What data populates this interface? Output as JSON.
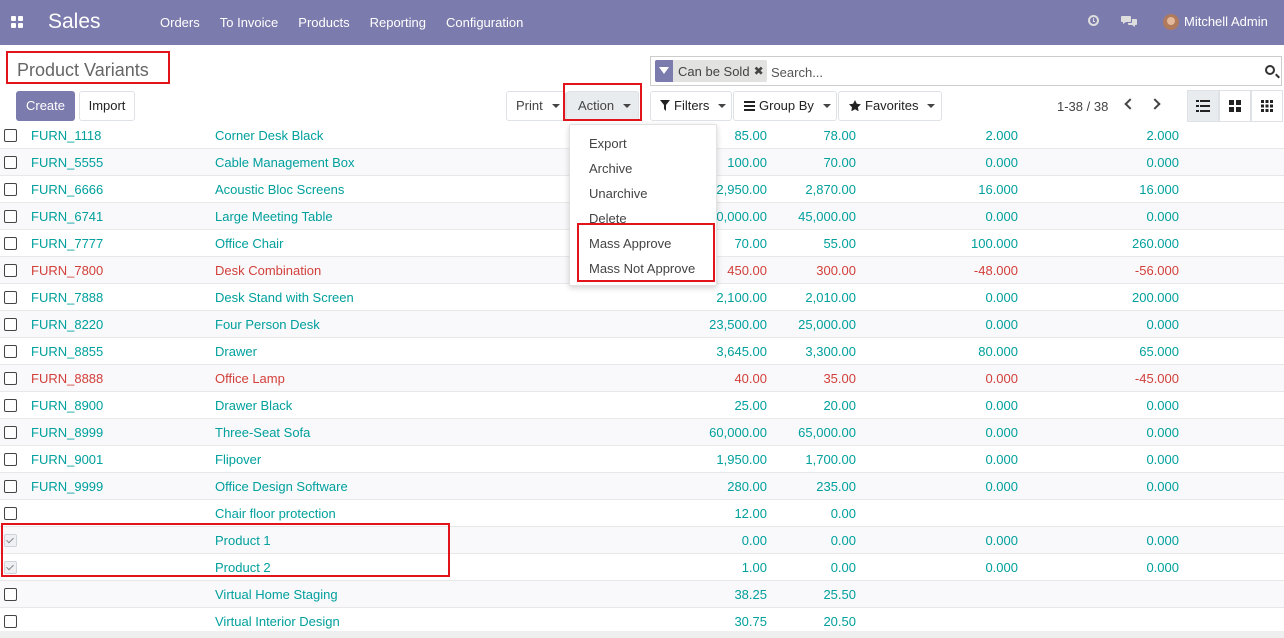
{
  "topbar": {
    "brand": "Sales",
    "menu": [
      "Orders",
      "To Invoice",
      "Products",
      "Reporting",
      "Configuration"
    ],
    "user": "Mitchell Admin"
  },
  "breadcrumb": {
    "title": "Product Variants"
  },
  "buttons": {
    "create": "Create",
    "import": "Import",
    "print": "Print",
    "action": "Action"
  },
  "search": {
    "facet": "Can be Sold",
    "placeholder": "Search..."
  },
  "filters": {
    "filters": "Filters",
    "groupby": "Group By",
    "favorites": "Favorites"
  },
  "pager": {
    "text": "1-38 / 38"
  },
  "action_menu": {
    "items": [
      "Export",
      "Archive",
      "Unarchive",
      "Delete",
      "Mass Approve",
      "Mass Not Approve"
    ]
  },
  "rows": [
    {
      "ref": "FURN_1118",
      "name": "Corner Desk Black",
      "price": "85.00",
      "cost": "78.00",
      "qty_on_hand": "2.000",
      "qty_forecast": "2.000",
      "state": "normal",
      "checked": false
    },
    {
      "ref": "FURN_5555",
      "name": "Cable Management Box",
      "price": "100.00",
      "cost": "70.00",
      "qty_on_hand": "0.000",
      "qty_forecast": "0.000",
      "state": "normal",
      "checked": false
    },
    {
      "ref": "FURN_6666",
      "name": "Acoustic Bloc Screens",
      "price": "2,950.00",
      "cost": "2,870.00",
      "qty_on_hand": "16.000",
      "qty_forecast": "16.000",
      "state": "normal",
      "checked": false
    },
    {
      "ref": "FURN_6741",
      "name": "Large Meeting Table",
      "price": "40,000.00",
      "cost": "45,000.00",
      "qty_on_hand": "0.000",
      "qty_forecast": "0.000",
      "state": "normal",
      "checked": false
    },
    {
      "ref": "FURN_7777",
      "name": "Office Chair",
      "price": "70.00",
      "cost": "55.00",
      "qty_on_hand": "100.000",
      "qty_forecast": "260.000",
      "state": "normal",
      "checked": false
    },
    {
      "ref": "FURN_7800",
      "name": "Desk Combination",
      "price": "450.00",
      "cost": "300.00",
      "qty_on_hand": "-48.000",
      "qty_forecast": "-56.000",
      "state": "red",
      "checked": false
    },
    {
      "ref": "FURN_7888",
      "name": "Desk Stand with Screen",
      "price": "2,100.00",
      "cost": "2,010.00",
      "qty_on_hand": "0.000",
      "qty_forecast": "200.000",
      "state": "normal",
      "checked": false
    },
    {
      "ref": "FURN_8220",
      "name": "Four Person Desk",
      "price": "23,500.00",
      "cost": "25,000.00",
      "qty_on_hand": "0.000",
      "qty_forecast": "0.000",
      "state": "normal",
      "checked": false
    },
    {
      "ref": "FURN_8855",
      "name": "Drawer",
      "price": "3,645.00",
      "cost": "3,300.00",
      "qty_on_hand": "80.000",
      "qty_forecast": "65.000",
      "state": "normal",
      "checked": false
    },
    {
      "ref": "FURN_8888",
      "name": "Office Lamp",
      "price": "40.00",
      "cost": "35.00",
      "qty_on_hand": "0.000",
      "qty_forecast": "-45.000",
      "state": "red",
      "checked": false
    },
    {
      "ref": "FURN_8900",
      "name": "Drawer Black",
      "price": "25.00",
      "cost": "20.00",
      "qty_on_hand": "0.000",
      "qty_forecast": "0.000",
      "state": "normal",
      "checked": false
    },
    {
      "ref": "FURN_8999",
      "name": "Three-Seat Sofa",
      "price": "60,000.00",
      "cost": "65,000.00",
      "qty_on_hand": "0.000",
      "qty_forecast": "0.000",
      "state": "normal",
      "checked": false
    },
    {
      "ref": "FURN_9001",
      "name": "Flipover",
      "price": "1,950.00",
      "cost": "1,700.00",
      "qty_on_hand": "0.000",
      "qty_forecast": "0.000",
      "state": "normal",
      "checked": false
    },
    {
      "ref": "FURN_9999",
      "name": "Office Design Software",
      "price": "280.00",
      "cost": "235.00",
      "qty_on_hand": "0.000",
      "qty_forecast": "0.000",
      "state": "normal",
      "checked": false
    },
    {
      "ref": "",
      "name": "Chair floor protection",
      "price": "12.00",
      "cost": "0.00",
      "qty_on_hand": "",
      "qty_forecast": "",
      "state": "normal",
      "checked": false
    },
    {
      "ref": "",
      "name": "Product 1",
      "price": "0.00",
      "cost": "0.00",
      "qty_on_hand": "0.000",
      "qty_forecast": "0.000",
      "state": "normal",
      "checked": true
    },
    {
      "ref": "",
      "name": "Product 2",
      "price": "1.00",
      "cost": "0.00",
      "qty_on_hand": "0.000",
      "qty_forecast": "0.000",
      "state": "normal",
      "checked": true
    },
    {
      "ref": "",
      "name": "Virtual Home Staging",
      "price": "38.25",
      "cost": "25.50",
      "qty_on_hand": "",
      "qty_forecast": "",
      "state": "normal",
      "checked": false
    },
    {
      "ref": "",
      "name": "Virtual Interior Design",
      "price": "30.75",
      "cost": "20.50",
      "qty_on_hand": "",
      "qty_forecast": "",
      "state": "normal",
      "checked": false
    }
  ]
}
